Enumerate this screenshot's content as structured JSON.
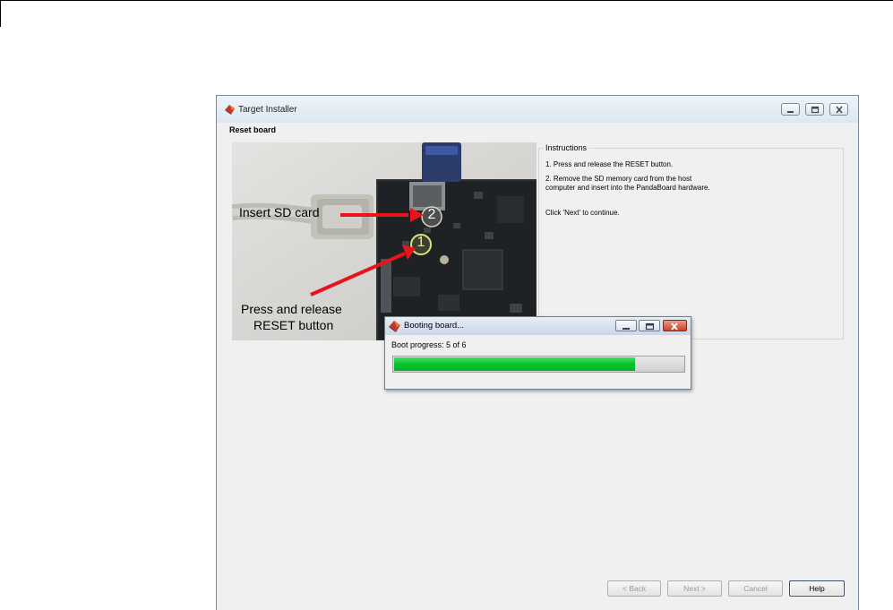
{
  "window": {
    "title": "Target Installer",
    "icon": "matlab-icon",
    "controls": [
      "minimize-icon",
      "maximize-icon",
      "close-icon"
    ]
  },
  "step": {
    "title": "Reset board"
  },
  "photo": {
    "label_insert": "Insert SD card",
    "label_press_line1": "Press and release",
    "label_press_line2": "RESET button",
    "marker_1": "1",
    "marker_2": "2",
    "arrow_color": "#e8141b"
  },
  "instructions": {
    "legend": "Instructions",
    "step1": "1. Press and release the RESET button.",
    "step2_line1": "2. Remove the SD memory card from the host",
    "step2_line2": "computer and insert into the PandaBoard hardware.",
    "continue": "Click 'Next' to continue."
  },
  "buttons": {
    "back": "< Back",
    "next": "Next >",
    "cancel": "Cancel",
    "help": "Help"
  },
  "dialog": {
    "title": "Booting board...",
    "progress_label": "Boot progress: 5 of 6",
    "progress_current": 5,
    "progress_total": 6,
    "progress_color": "#07c12c"
  }
}
